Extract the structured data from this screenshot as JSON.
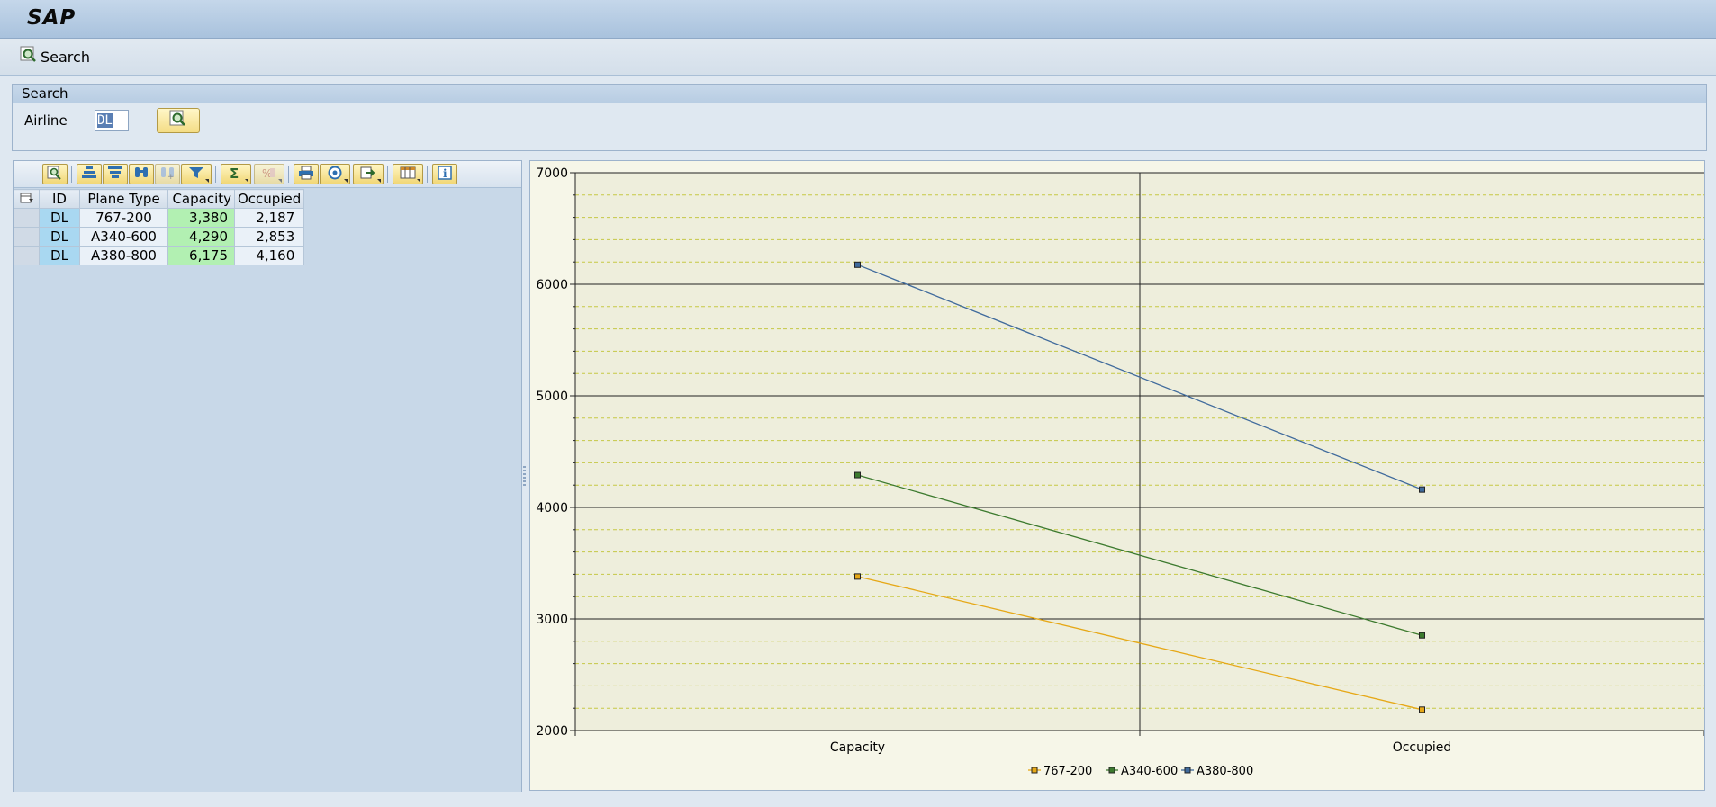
{
  "window": {
    "title": "SAP"
  },
  "toolbar": {
    "search_label": "Search"
  },
  "search": {
    "frame_title": "Search",
    "airline_label": "Airline",
    "airline_value": "DL"
  },
  "grid": {
    "columns": [
      "ID",
      "Plane Type",
      "Capacity",
      "Occupied"
    ],
    "rows": [
      {
        "id": "DL",
        "plane_type": "767-200",
        "capacity": "3,380",
        "occupied": "2,187"
      },
      {
        "id": "DL",
        "plane_type": "A340-600",
        "capacity": "4,290",
        "occupied": "2,853"
      },
      {
        "id": "DL",
        "plane_type": "A380-800",
        "capacity": "6,175",
        "occupied": "4,160"
      }
    ],
    "toolbar_icons": [
      "details-icon",
      "sort-ascending-icon",
      "sort-descending-icon",
      "find-icon",
      "find-next-icon",
      "filter-icon",
      "sum-icon",
      "subtotal-icon",
      "print-icon",
      "views-icon",
      "export-icon",
      "layout-icon",
      "info-icon"
    ]
  },
  "colors": {
    "767-200": "#e6a817",
    "A340-600": "#3c7a2e",
    "A380-800": "#3f6a9c",
    "plot_bg": "#eeeedc"
  },
  "chart_data": {
    "type": "line",
    "categories": [
      "Capacity",
      "Occupied"
    ],
    "series": [
      {
        "name": "767-200",
        "values": [
          3380,
          2187
        ]
      },
      {
        "name": "A340-600",
        "values": [
          4290,
          2853
        ]
      },
      {
        "name": "A380-800",
        "values": [
          6175,
          4160
        ]
      }
    ],
    "ylim": [
      2000,
      7000
    ],
    "yticks": [
      "2000",
      "3000",
      "4000",
      "5000",
      "6000",
      "7000"
    ],
    "grid": true,
    "legend_position": "bottom"
  }
}
